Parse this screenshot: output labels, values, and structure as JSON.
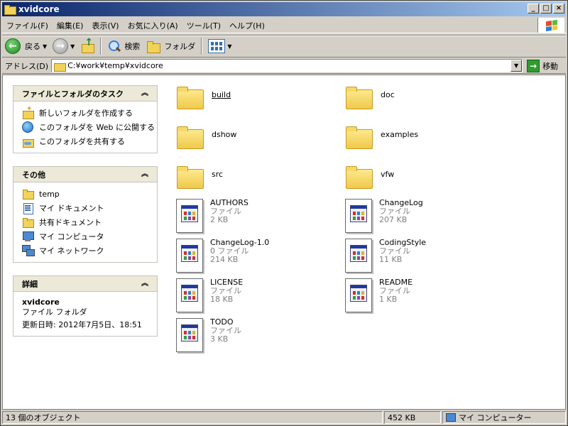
{
  "window": {
    "title": "xvidcore"
  },
  "menu": [
    "ファイル(F)",
    "編集(E)",
    "表示(V)",
    "お気に入り(A)",
    "ツール(T)",
    "ヘルプ(H)"
  ],
  "toolbar": {
    "back_label": "戻る",
    "search_label": "検索",
    "folders_label": "フォルダ"
  },
  "address": {
    "label": "アドレス(D)",
    "value": "C:¥work¥temp¥xvidcore",
    "go_label": "移動"
  },
  "tasks_panel": {
    "title": "ファイルとフォルダのタスク",
    "items": [
      "新しいフォルダを作成する",
      "このフォルダを Web に公開する",
      "このフォルダを共有する"
    ]
  },
  "other_panel": {
    "title": "その他",
    "items": [
      "temp",
      "マイ ドキュメント",
      "共有ドキュメント",
      "マイ コンピュータ",
      "マイ ネットワーク"
    ]
  },
  "details_panel": {
    "title": "詳細",
    "name": "xvidcore",
    "type": "ファイル フォルダ",
    "modified": "更新日時: 2012年7月5日、18:51"
  },
  "folders": [
    "build",
    "doc",
    "dshow",
    "examples",
    "src",
    "vfw"
  ],
  "files": [
    {
      "name": "AUTHORS",
      "type": "ファイル",
      "size": "2 KB"
    },
    {
      "name": "ChangeLog",
      "type": "ファイル",
      "size": "207 KB"
    },
    {
      "name": "ChangeLog-1.0",
      "type": "0 ファイル",
      "size": "214 KB"
    },
    {
      "name": "CodingStyle",
      "type": "ファイル",
      "size": "11 KB"
    },
    {
      "name": "LICENSE",
      "type": "ファイル",
      "size": "18 KB"
    },
    {
      "name": "README",
      "type": "ファイル",
      "size": "1 KB"
    },
    {
      "name": "TODO",
      "type": "ファイル",
      "size": "3 KB"
    }
  ],
  "status": {
    "objects": "13 個のオブジェクト",
    "size": "452 KB",
    "location": "マイ コンピューター"
  }
}
